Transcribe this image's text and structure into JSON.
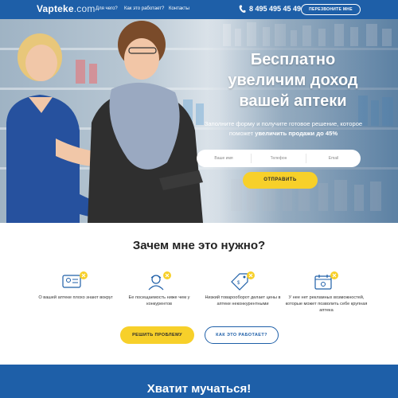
{
  "nav": {
    "logo": "Vapteke",
    "logo_suffix": ".com",
    "links": [
      {
        "label": "Для чего?"
      },
      {
        "label": "Как это работает?"
      },
      {
        "label": "Контакты"
      }
    ],
    "phone": "8 495 495 45 49",
    "callback_label": "ПЕРЕЗВОНИТЕ МНЕ"
  },
  "hero": {
    "title_lines": [
      "Бесплатно",
      "увеличим доход",
      "вашей аптеки"
    ],
    "subtitle_plain": "Заполните форму и получите готовое решение, которое поможет",
    "subtitle_bold": "увеличить продажи до 45%",
    "form": {
      "name_placeholder": "Ваше имя",
      "phone_placeholder": "Телефон",
      "email_placeholder": "Email"
    },
    "send_label": "ОТПРАВИТЬ"
  },
  "why": {
    "title": "Зачем мне это нужно?",
    "features": [
      {
        "icon": "id-card-icon",
        "text": "О вашей аптеке плохо знают вокруг"
      },
      {
        "icon": "customer-icon",
        "text": "Ее посещаемость ниже чем у конкурентов"
      },
      {
        "icon": "price-tag-icon",
        "text": "Низкий товарооборот делает цены в аптеке неконкурентными"
      },
      {
        "icon": "calendar-icon",
        "text": "У нее нет рекламных возможностей, которые может позволить себе крупная аптека"
      }
    ],
    "solve_label": "РЕШИТЬ ПРОБЛЕМУ",
    "how_label": "КАК ЭТО РАБОТАЕТ?"
  },
  "band": {
    "title": "Хватит мучаться!"
  },
  "colors": {
    "primary": "#1e5fa8",
    "accent": "#f7d02a",
    "text": "#222222"
  }
}
